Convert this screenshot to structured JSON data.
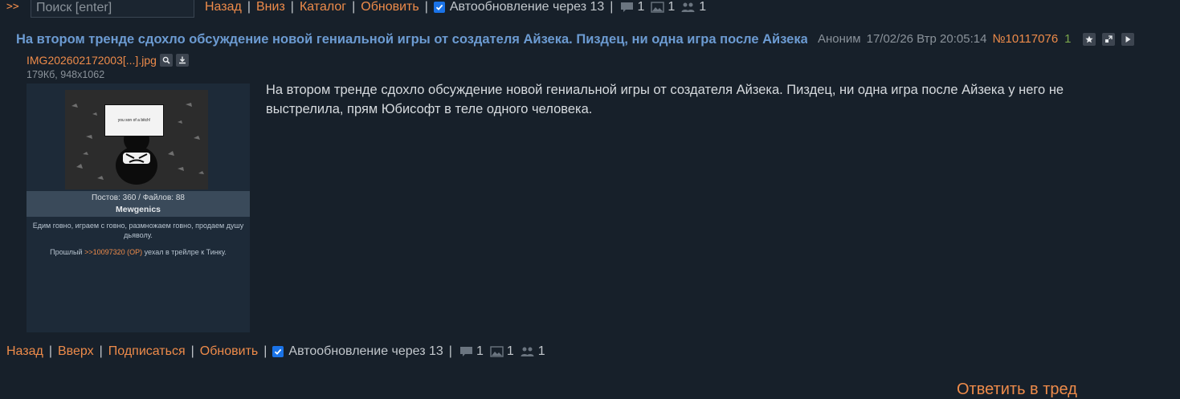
{
  "topbar": {
    "arrows": ">>",
    "search_placeholder": "Поиск [enter]",
    "links": [
      "Назад",
      "Вниз",
      "Каталог",
      "Обновить"
    ],
    "autoupdate_label": "Автообновление через 13",
    "autoupdate_checked": true,
    "posts_count": "1",
    "images_count": "1",
    "posters_count": "1"
  },
  "post": {
    "title": "На втором тренде сдохло обсуждение новой гениальной игры от создателя Айзека. Пиздец, ни одна игра после Айзека у него не выстрелила, прям Юбисофт в теле одного человека.",
    "author": "Аноним",
    "datetime": "17/02/26 Втр 20:05:14",
    "number": "№10117076",
    "replies": "1",
    "file": {
      "name": "IMG202602172003[...].jpg",
      "info": "179Кб, 948x1062",
      "thumb": {
        "bubble_text": "you son of a bitch!",
        "stats": "Постов: 360 / Файлов: 88",
        "name": "Mewgenics",
        "description": "Едим говно, играем с говно, размножаем говно, продаем душу дьяволу.",
        "prev_prefix": "Прошлый",
        "prev_ref": ">>10097320 (OP)",
        "prev_suffix": "уехал в трейлре к Тинку."
      }
    },
    "body_line1": "На втором тренде сдохло обсуждение новой гениальной игры от создателя Айзека. Пиздец, ни одна игра после Айзека у него не",
    "body_line2": "выстрелила, прям Юбисофт в теле одного человека."
  },
  "bottombar": {
    "links": [
      "Назад",
      "Вверх",
      "Подписаться",
      "Обновить"
    ],
    "autoupdate_label": "Автообновление через 13",
    "autoupdate_checked": true,
    "posts_count": "1",
    "images_count": "1",
    "posters_count": "1"
  },
  "reply_link": "Ответить в тред",
  "colors": {
    "background": "#17202a",
    "link": "#ee8b4a",
    "title": "#6c9bd2",
    "replies": "#7aa64b",
    "checkbox": "#1a73e8"
  },
  "icons": [
    "comment-icon",
    "image-icon",
    "users-icon",
    "star-icon",
    "expand-icon",
    "play-icon",
    "search-icon",
    "download-icon"
  ]
}
